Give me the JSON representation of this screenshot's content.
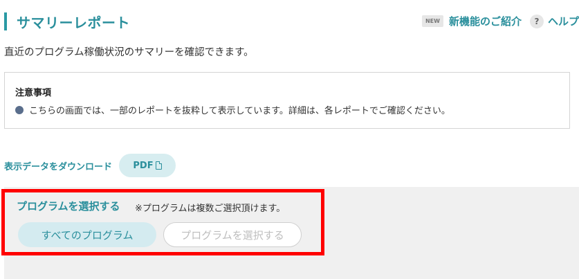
{
  "header": {
    "title": "サマリーレポート",
    "new_badge": "NEW",
    "new_features_link": "新機能のご紹介",
    "help_icon": "?",
    "help_link": "ヘルプ"
  },
  "description": "直近のプログラム稼働状況のサマリーを確認できます。",
  "notice": {
    "title": "注意事項",
    "items": [
      "こちらの画面では、一部のレポートを抜粋して表示しています。詳細は、各レポートでご確認ください。"
    ]
  },
  "download": {
    "label": "表示データをダウンロード",
    "pdf_button": "PDF"
  },
  "program_select": {
    "title": "プログラムを選択する",
    "note": "※プログラムは複数ご選択頂けます。",
    "all_button": "すべてのプログラム",
    "select_button": "プログラムを選択する"
  },
  "colors": {
    "accent": "#2a8f9c",
    "highlight": "#ff0000",
    "button_bg": "#d4ebf0"
  }
}
